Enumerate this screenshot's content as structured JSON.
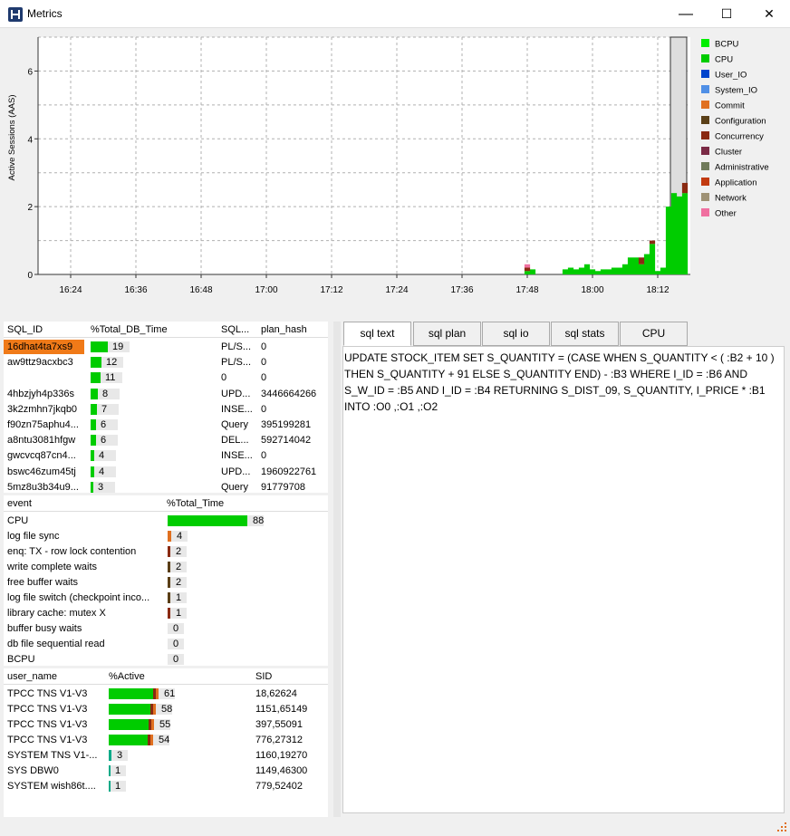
{
  "window": {
    "title": "Metrics",
    "minimize": "—",
    "maximize": "☐",
    "close": "✕"
  },
  "chart_data": {
    "type": "area",
    "ylabel": "Active Sessions (AAS)",
    "ylim": [
      0,
      7
    ],
    "yticks": [
      "0",
      "2",
      "4",
      "6"
    ],
    "xticks": [
      "16:24",
      "16:36",
      "16:48",
      "17:00",
      "17:12",
      "17:24",
      "17:36",
      "17:48",
      "18:00",
      "18:12"
    ],
    "legend": [
      "BCPU",
      "CPU",
      "User_IO",
      "System_IO",
      "Commit",
      "Configuration",
      "Concurrency",
      "Cluster",
      "Administrative",
      "Application",
      "Network",
      "Other"
    ],
    "colors": {
      "BCPU": "#00ee00",
      "CPU": "#00cc00",
      "User_IO": "#0044cc",
      "System_IO": "#4f8fe6",
      "Commit": "#e07020",
      "Configuration": "#5a3f17",
      "Concurrency": "#8a2a12",
      "Cluster": "#7a2a45",
      "Administrative": "#707b5a",
      "Application": "#c23a10",
      "Network": "#9f9275",
      "Other": "#f070a0"
    },
    "series": [
      {
        "name": "CPU",
        "x": [
          "17:48",
          "17:49",
          "17:55",
          "17:56",
          "17:57",
          "17:58",
          "17:59",
          "18:00",
          "18:01",
          "18:02",
          "18:03",
          "18:04",
          "18:05",
          "18:06",
          "18:07",
          "18:08",
          "18:09",
          "18:10",
          "18:11",
          "18:12",
          "18:13",
          "18:14",
          "18:15",
          "18:16",
          "18:17"
        ],
        "values": [
          0.1,
          0.15,
          0.15,
          0.2,
          0.15,
          0.2,
          0.3,
          0.15,
          0.1,
          0.15,
          0.15,
          0.2,
          0.2,
          0.3,
          0.5,
          0.5,
          0.3,
          0.6,
          0.9,
          0.1,
          0.2,
          2.0,
          2.4,
          2.3,
          2.4
        ]
      },
      {
        "name": "Concurrency",
        "x": [
          "17:48",
          "18:09",
          "18:11",
          "18:17"
        ],
        "values": [
          0.1,
          0.2,
          0.1,
          0.3
        ]
      },
      {
        "name": "Other",
        "x": [
          "17:48"
        ],
        "values": [
          0.1
        ]
      }
    ]
  },
  "sql_table": {
    "headers": [
      "SQL_ID",
      "%Total_DB_Time",
      "SQL...",
      "plan_hash"
    ],
    "rows": [
      {
        "id": "16dhat4ta7xs9",
        "pct": 19,
        "type": "PL/S...",
        "plan": "0"
      },
      {
        "id": "aw9ttz9acxbc3",
        "pct": 12,
        "type": "PL/S...",
        "plan": "0"
      },
      {
        "id": "",
        "pct": 11,
        "type": "0",
        "plan": "0"
      },
      {
        "id": "4hbzjyh4p336s",
        "pct": 8,
        "type": "UPD...",
        "plan": "3446664266"
      },
      {
        "id": "3k2zmhn7jkqb0",
        "pct": 7,
        "type": "INSE...",
        "plan": "0"
      },
      {
        "id": "f90zn75aphu4...",
        "pct": 6,
        "type": "Query",
        "plan": "395199281"
      },
      {
        "id": "a8ntu3081hfgw",
        "pct": 6,
        "type": "DEL...",
        "plan": "592714042"
      },
      {
        "id": "gwcvcq87cn4...",
        "pct": 4,
        "type": "INSE...",
        "plan": "0"
      },
      {
        "id": "bswc46zum45tj",
        "pct": 4,
        "type": "UPD...",
        "plan": "1960922761"
      },
      {
        "id": "5mz8u3b34u9...",
        "pct": 3,
        "type": "Query",
        "plan": "91779708"
      }
    ]
  },
  "event_table": {
    "headers": [
      "event",
      "%Total_Time"
    ],
    "rows": [
      {
        "name": "CPU",
        "pct": 88,
        "color": "#00cc00"
      },
      {
        "name": "log file sync",
        "pct": 4,
        "color": "#e07020"
      },
      {
        "name": "enq: TX - row lock contention",
        "pct": 2,
        "color": "#8a2a12"
      },
      {
        "name": "write complete waits",
        "pct": 2,
        "color": "#5a3f17"
      },
      {
        "name": "free buffer waits",
        "pct": 2,
        "color": "#5a3f17"
      },
      {
        "name": "log file switch (checkpoint inco...",
        "pct": 1,
        "color": "#5a3f17"
      },
      {
        "name": "library cache: mutex X",
        "pct": 1,
        "color": "#8a2a12"
      },
      {
        "name": "buffer busy waits",
        "pct": 0,
        "color": "#8a2a12"
      },
      {
        "name": "db file sequential read",
        "pct": 0,
        "color": "#0044cc"
      },
      {
        "name": "BCPU",
        "pct": 0,
        "color": "#00ee00"
      }
    ]
  },
  "session_table": {
    "headers": [
      "user_name",
      "%Active",
      "SID"
    ],
    "rows": [
      {
        "user": "TPCC TNS V1-V3",
        "pct": 61,
        "sid": "18,62624"
      },
      {
        "user": "TPCC TNS V1-V3",
        "pct": 58,
        "sid": "1151,65149"
      },
      {
        "user": "TPCC TNS V1-V3",
        "pct": 55,
        "sid": "397,55091"
      },
      {
        "user": "TPCC TNS V1-V3",
        "pct": 54,
        "sid": "776,27312"
      },
      {
        "user": "SYSTEM TNS V1-...",
        "pct": 3,
        "sid": "1160,19270"
      },
      {
        "user": "SYS DBW0",
        "pct": 1,
        "sid": "1149,46300"
      },
      {
        "user": "SYSTEM wish86t....",
        "pct": 1,
        "sid": "779,52402"
      }
    ]
  },
  "tabs": [
    "sql text",
    "sql plan",
    "sql io",
    "sql stats",
    "CPU"
  ],
  "sql_text": "UPDATE STOCK_ITEM SET S_QUANTITY = (CASE WHEN S_QUANTITY < ( :B2 + 10 ) THEN S_QUANTITY + 91 ELSE S_QUANTITY END) - :B3 WHERE I_ID = :B6 AND S_W_ID = :B5 AND I_ID = :B4 RETURNING S_DIST_09, S_QUANTITY, I_PRICE * :B1 INTO :O0 ,:O1 ,:O2"
}
